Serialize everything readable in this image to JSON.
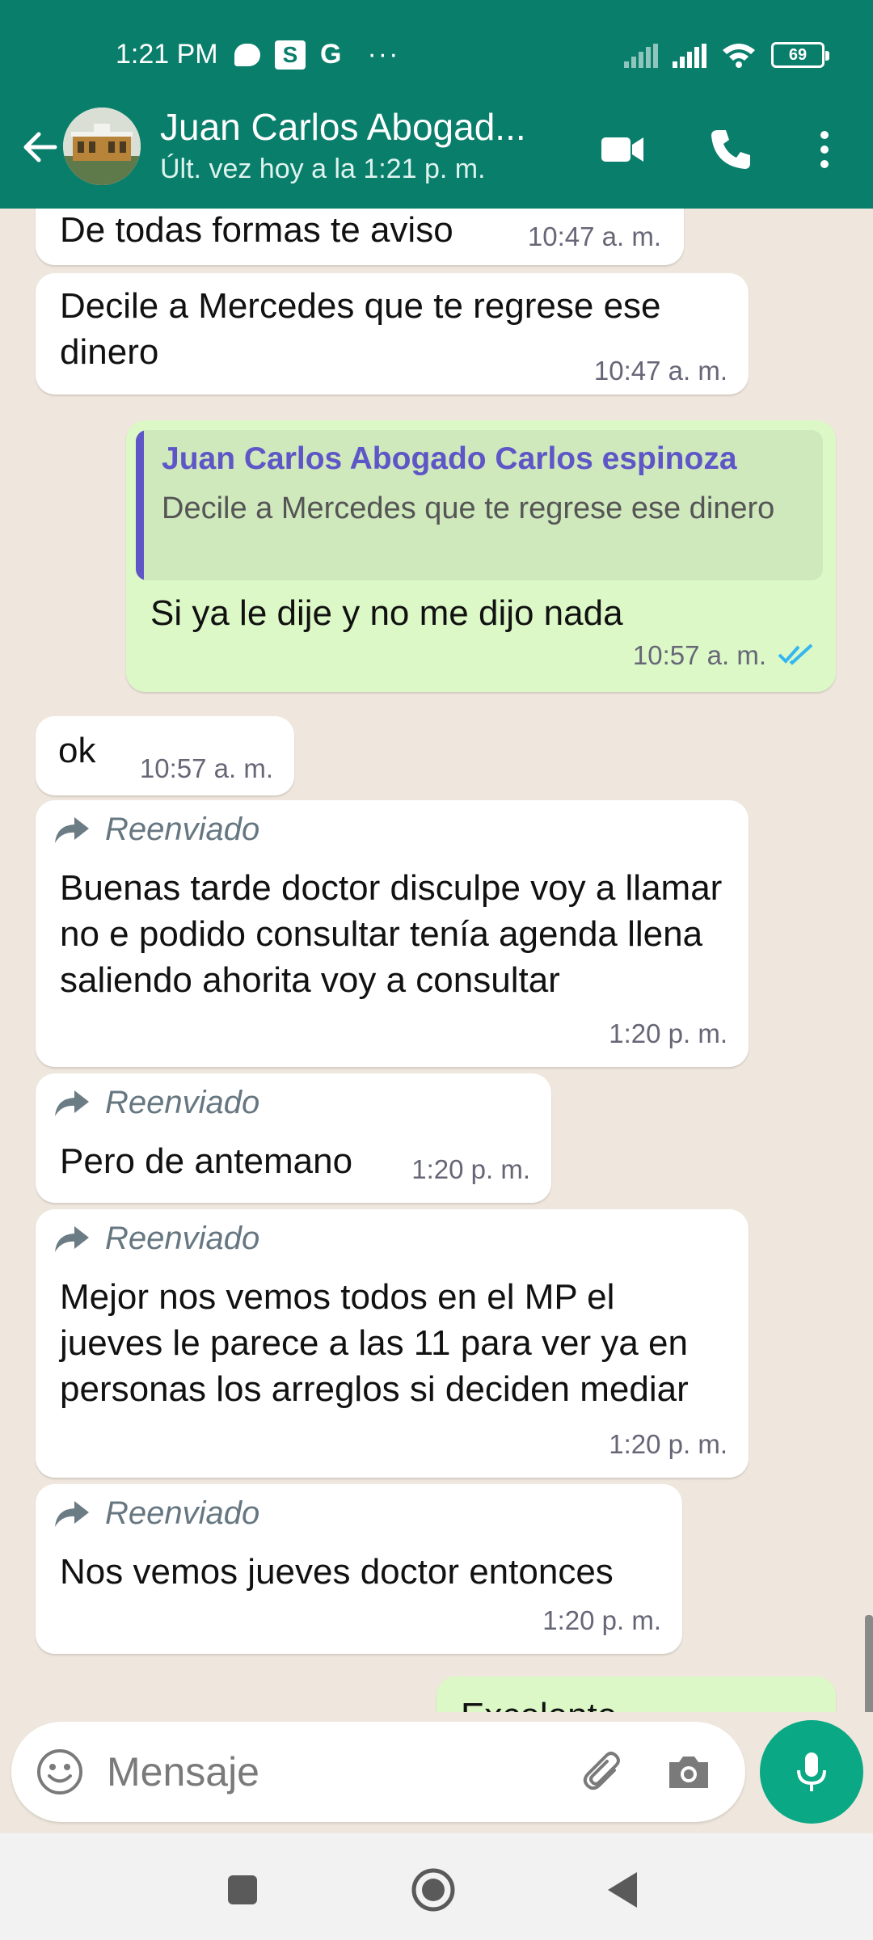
{
  "status_bar": {
    "time": "1:21 PM",
    "battery": "69",
    "icons": [
      "chat-bubble-icon",
      "s-app-icon",
      "g-app-icon",
      "more-dots-icon",
      "signal-icon",
      "signal-icon",
      "wifi-icon",
      "battery-icon"
    ],
    "notif_g": "G",
    "notif_s": "S",
    "notif_more": "···"
  },
  "header": {
    "name": "Juan Carlos Abogad...",
    "status": "Últ. vez hoy a la 1:21 p. m.",
    "icons": [
      "back-arrow-icon",
      "video-call-icon",
      "phone-call-icon",
      "more-vert-icon"
    ]
  },
  "messages": [
    {
      "direction": "in",
      "text": "De todas formas te aviso",
      "time": "10:47 a. m."
    },
    {
      "direction": "in",
      "text": "Decile a Mercedes que te regrese ese dinero",
      "time": "10:47 a. m."
    },
    {
      "direction": "out",
      "quote_author": "Juan Carlos Abogado Carlos espinoza",
      "quote_text": "Decile a Mercedes que te regrese ese dinero",
      "text": "Si ya le dije y no me dijo nada",
      "time": "10:57 a. m.",
      "read": true
    },
    {
      "direction": "in",
      "text": "ok",
      "time": "10:57 a. m."
    },
    {
      "direction": "in",
      "forwarded": "Reenviado",
      "text": "Buenas tarde doctor disculpe voy a llamar no e podido consultar tenía agenda llena saliendo ahorita voy a consultar",
      "time": "1:20 p. m."
    },
    {
      "direction": "in",
      "forwarded": "Reenviado",
      "text": "Pero de antemano",
      "time": "1:20 p. m."
    },
    {
      "direction": "in",
      "forwarded": "Reenviado",
      "text": "Mejor nos vemos todos en el MP el jueves le parece a las 11 para ver ya en personas los arreglos si deciden mediar",
      "time": "1:20 p. m."
    },
    {
      "direction": "in",
      "forwarded": "Reenviado",
      "text": "Nos vemos jueves doctor entonces",
      "time": "1:20 p. m."
    },
    {
      "direction": "out",
      "text": "Excelente",
      "time": ""
    }
  ],
  "composer": {
    "placeholder": "Mensaje",
    "icons": [
      "emoji-icon",
      "attach-icon",
      "camera-icon",
      "mic-icon"
    ]
  },
  "colors": {
    "header": "#087e6b",
    "incoming": "#ffffff",
    "outgoing": "#dcf8c6",
    "accent": "#0aa885",
    "quote_author": "#5e55c7",
    "read_ticks": "#34b7f1"
  }
}
